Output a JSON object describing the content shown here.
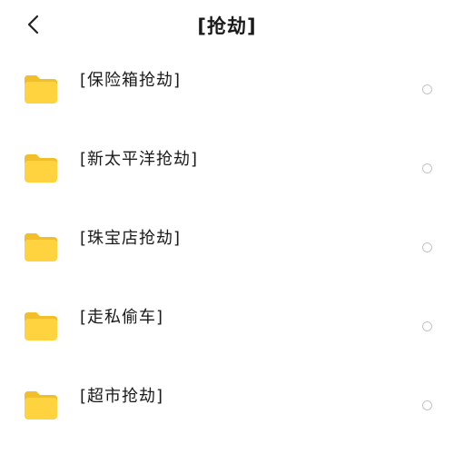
{
  "header": {
    "title": "[抢劫]",
    "back_icon": "chevron-left-icon"
  },
  "colors": {
    "folder_body": "#FFD23F",
    "folder_tab": "#F2BE2A",
    "radio_border": "#C4C4C4"
  },
  "folders": [
    {
      "name": "[保险箱抢劫]",
      "selected": false
    },
    {
      "name": "[新太平洋抢劫]",
      "selected": false
    },
    {
      "name": "[珠宝店抢劫]",
      "selected": false
    },
    {
      "name": "[走私偷车]",
      "selected": false
    },
    {
      "name": "[超市抢劫]",
      "selected": false
    }
  ]
}
